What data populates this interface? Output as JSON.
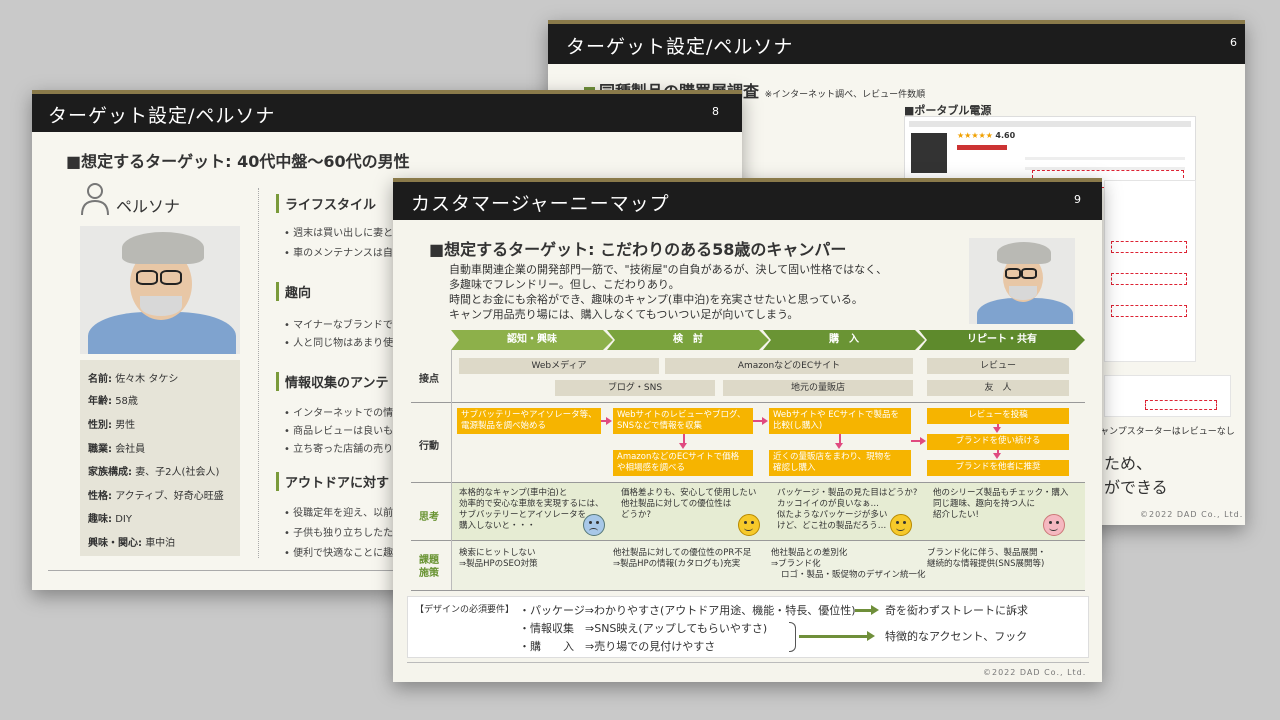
{
  "slide6": {
    "title": "ターゲット設定/ペルソナ",
    "page": "6",
    "heading": "同種製品の購買層調査",
    "note": "※インターネット調べ、レビュー件数順",
    "section": "■ポータブル電源",
    "rating": "4.60",
    "review_note": "ャンプスターターはレビューなし",
    "partial_line1": "ため、",
    "partial_line2": "ができる",
    "copyright": "©2022 DAD Co., Ltd."
  },
  "slide8": {
    "title": "ターゲット設定/ペルソナ",
    "page": "8",
    "heading": "■想定するターゲット: 40代中盤～60代の男性",
    "persona_label": "ペルソナ",
    "profile": [
      {
        "k": "名前:",
        "v": "佐々木 タケシ"
      },
      {
        "k": "年齢:",
        "v": "58歳"
      },
      {
        "k": "性別:",
        "v": "男性"
      },
      {
        "k": "職業:",
        "v": "会社員"
      },
      {
        "k": "家族構成:",
        "v": "妻、子2人(社会人)"
      },
      {
        "k": "性格:",
        "v": "アクティブ、好奇心旺盛"
      },
      {
        "k": "趣味:",
        "v": "DIY"
      },
      {
        "k": "興味・関心:",
        "v": "車中泊"
      }
    ],
    "sections": [
      {
        "title": "ライフスタイル",
        "bullets": [
          "週末は買い出しに妻と",
          "車のメンテナンスは自"
        ]
      },
      {
        "title": "趣向",
        "bullets": [
          "マイナーなブランドで",
          "人と同じ物はあまり使"
        ]
      },
      {
        "title": "情報収集のアンテ",
        "bullets": [
          "インターネットでの情",
          "商品レビューは良いも",
          "立ち寄った店舗の売り"
        ]
      },
      {
        "title": "アウトドアに対す",
        "bullets": [
          "役職定年を迎え、以前",
          "子供も独り立ちしたた",
          "便利で快適なことに趣"
        ]
      }
    ]
  },
  "slide9": {
    "title": "カスタマージャーニーマップ",
    "page": "9",
    "heading": "■想定するターゲット: こだわりのある58歳のキャンパー",
    "desc": [
      "自動車関連企業の開発部門一筋で、\"技術屋\"の自負があるが、決して固い性格ではなく、",
      "多趣味でフレンドリー。但し、こだわりあり。",
      "時間とお金にも余裕ができ、趣味のキャンプ(車中泊)を充実させたいと思っている。",
      "キャンプ用品売り場には、購入しなくてもついつい足が向いてしまう。"
    ],
    "phases": [
      "認知・興味",
      "検　討",
      "購　入",
      "リピート・共有"
    ],
    "rows": {
      "touch": "接点",
      "action": "行動",
      "thought": "思考",
      "issue1": "課題",
      "issue2": "施策"
    },
    "touchpoints": [
      "Webメディア",
      "AmazonなどのECサイト",
      "レビュー",
      "ブログ・SNS",
      "地元の量販店",
      "友　人"
    ],
    "actions": [
      [
        "サブバッテリーやアイソレータ等、",
        "電源製品を調べ始める"
      ],
      [
        "Webサイトのレビューやブログ、",
        "SNSなどで情報を収集"
      ],
      [
        "AmazonなどのECサイトで価格",
        "や相場感を調べる"
      ],
      [
        "Webサイトや ECサイトで製品を",
        "比較(し購入)"
      ],
      [
        "近くの量販店をまわり、現物を",
        "確認し購入"
      ],
      [
        "レビューを投稿"
      ],
      [
        "ブランドを使い続ける"
      ],
      [
        "ブランドを他者に推奨"
      ]
    ],
    "thoughts": [
      [
        "本格的なキャンプ(車中泊)と",
        "効率的で安心な車旅を実現するには、",
        "サブバッテリーとアイソレータを",
        "購入しないと・・・"
      ],
      [
        "価格差よりも、安心して使用したい",
        "他社製品に対しての優位性は",
        "どうか?"
      ],
      [
        "パッケージ・製品の見た目はどうか?",
        "カッコイイのが良いなぁ…",
        "似たようなパッケージが多い",
        "けど、どこ社の製品だろう…"
      ],
      [
        "他のシリーズ製品もチェック・購入",
        "同じ趣味、趣向を持つ人に",
        "紹介したい!"
      ]
    ],
    "issues": [
      [
        "検索にヒットしない",
        "⇒製品HPのSEO対策"
      ],
      [
        "他社製品に対しての優位性のPR不足",
        "⇒製品HPの情報(カタログも)充実"
      ],
      [
        "他社製品との差別化",
        "⇒ブランド化",
        "ロゴ・製品・販促物のデザイン統一化"
      ],
      [
        "ブランド化に伴う、製品展開・",
        "継続的な情報提供(SNS展開等)"
      ]
    ],
    "req_label": "【デザインの必須要件】",
    "reqs": [
      "・パッケージ⇒わかりやすさ(アウトドア用途、機能・特長、優位性)",
      "・情報収集　⇒SNS映え(アップしてもらいやすさ)",
      "・購　　入　⇒売り場での見付けやすさ"
    ],
    "req_result1": "奇を衒わずストレートに訴求",
    "req_result2": "特徴的なアクセント、フック",
    "copyright": "©2022 DAD Co., Ltd.",
    "colors": {
      "phase1": "#8db04a",
      "phase2": "#7aa33d",
      "phase3": "#6a9434",
      "phase4": "#5e8a2c",
      "action": "#f6b400",
      "arrow": "#e04a80",
      "band": "#e6ecd3"
    }
  }
}
